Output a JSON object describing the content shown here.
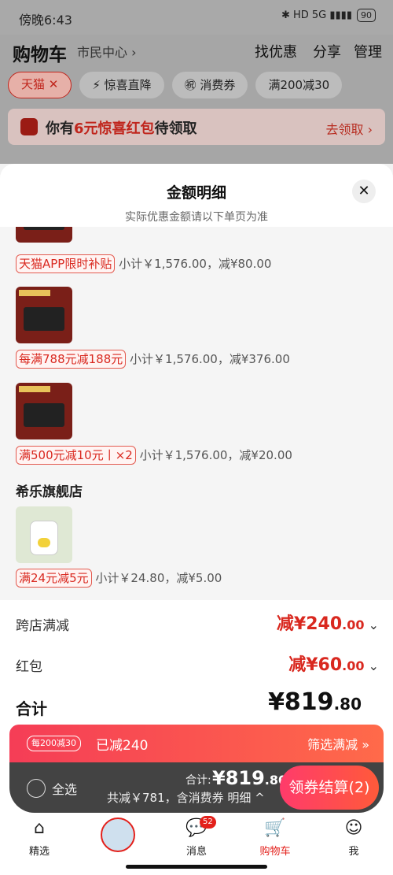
{
  "status": {
    "time": "傍晚6:43",
    "icons": "✱ HD 5G ▮▮▮▮",
    "battery": "90"
  },
  "header": {
    "title": "购物车",
    "location": "市民中心 ›",
    "actions": [
      "找优惠",
      "分享",
      "管理"
    ]
  },
  "chips": [
    {
      "label": "天猫 ✕",
      "active": true
    },
    {
      "label": "⚡ 惊喜直降",
      "active": false
    },
    {
      "label": "㊗ 消费券",
      "active": false
    },
    {
      "label": "满200减30",
      "active": false
    }
  ],
  "red_banner": {
    "text_pre": "你有",
    "amount": "6元惊喜红包",
    "text_post": "待领取",
    "action": "去领取 ›"
  },
  "sheet": {
    "title": "金额明细",
    "subtitle": "实际优惠金额请以下单页为准",
    "close": "✕",
    "items": [
      {
        "tag": "天猫APP限时补贴",
        "detail": "小计￥1,576.00，减¥80.00"
      },
      {
        "tag": "每满788元减188元",
        "detail": "小计￥1,576.00，减¥376.00"
      },
      {
        "tag": "满500元减10元丨×2",
        "detail": "小计￥1,576.00，减¥20.00"
      }
    ],
    "store2": "希乐旗舰店",
    "store2_item": {
      "tag": "满24元减5元",
      "detail": "小计￥24.80，减¥5.00"
    },
    "cross_store": {
      "label": "跨店满减",
      "value": "减¥240",
      "decimal": ".00"
    },
    "red_packet": {
      "label": "红包",
      "value": "减¥60",
      "decimal": ".00"
    },
    "total": {
      "label": "合计",
      "value": "¥819",
      "decimal": ".80"
    }
  },
  "promo": {
    "tag": "每200减30",
    "cut": "已减240",
    "filter": "筛选满减 »"
  },
  "checkout": {
    "select_all": "全选",
    "total_label": "合计:",
    "total_value": "¥819",
    "total_decimal": ".80",
    "saved": "共减￥781，含消费券  明细 ^",
    "pay": "领券结算(2)"
  },
  "tabbar": [
    {
      "label": "精选",
      "icon": "home-icon"
    },
    {
      "label": "",
      "icon": "avatar-icon"
    },
    {
      "label": "消息",
      "icon": "message-icon",
      "badge": "52"
    },
    {
      "label": "购物车",
      "icon": "cart-icon"
    },
    {
      "label": "我",
      "icon": "profile-icon"
    }
  ],
  "colors": {
    "accent": "#d9281f",
    "pay_gradient": "#ff3b6b",
    "dark_bar": "#434343"
  }
}
